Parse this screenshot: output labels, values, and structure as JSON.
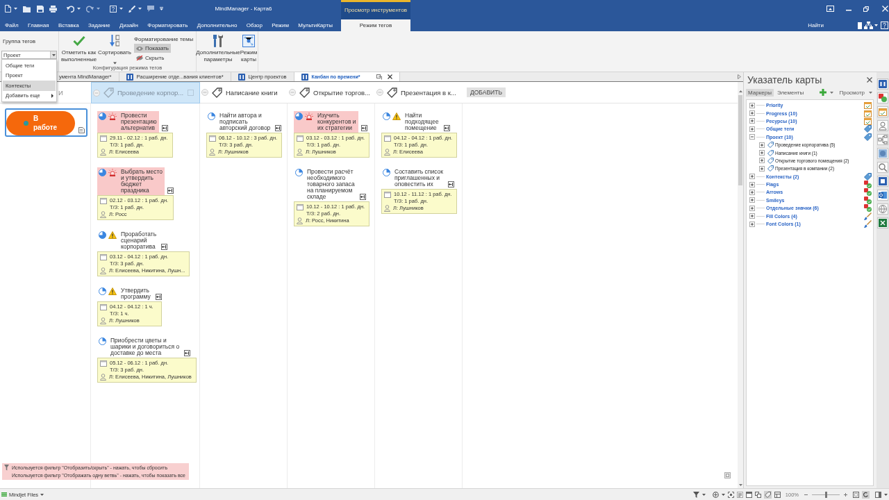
{
  "window": {
    "title": "MindManager - Карта6",
    "contextual_group": "Просмотр инструментов"
  },
  "ribbon": {
    "tabs": [
      {
        "label": "Файл",
        "kind": "standard",
        "selected": false
      },
      {
        "label": "Главная",
        "kind": "standard",
        "selected": false
      },
      {
        "label": "Вставка",
        "kind": "standard",
        "selected": false
      },
      {
        "label": "Задание",
        "kind": "standard",
        "selected": false
      },
      {
        "label": "Дизайн",
        "kind": "standard",
        "selected": false
      },
      {
        "label": "Форматировать",
        "kind": "standard",
        "selected": false
      },
      {
        "label": "Дополнительно",
        "kind": "standard",
        "selected": false
      },
      {
        "label": "Обзор",
        "kind": "standard",
        "selected": false
      },
      {
        "label": "Режим",
        "kind": "standard",
        "selected": false
      },
      {
        "label": "МультиКарты",
        "kind": "standard",
        "selected": false
      },
      {
        "label": "Режим тегов",
        "kind": "contextual",
        "selected": true
      }
    ],
    "search_label": "Найти",
    "tag_group": {
      "label": "Группа тегов",
      "value": "Проект",
      "menu": [
        {
          "label": "Общие теги",
          "highlighted": false,
          "submenu": false
        },
        {
          "label": "Проект",
          "highlighted": false,
          "submenu": false
        },
        {
          "label": "Контексты",
          "highlighted": true,
          "submenu": false
        },
        {
          "label": "Добавить еще",
          "highlighted": false,
          "submenu": true
        }
      ]
    },
    "mark_done_button": {
      "label": "Отметить как\nвыполненные"
    },
    "sort_button": {
      "label": "Сортировать"
    },
    "theme_formatting": {
      "label": "Форматирование темы",
      "options": [
        {
          "label": "Показать",
          "selected": true
        },
        {
          "label": "Скрыть",
          "selected": false
        }
      ]
    },
    "group_label": "Конфигурация режима тегов",
    "more_options_button": {
      "label": "Дополнительные\nпараметры"
    },
    "map_mode_button": {
      "label": "Режим\nкарты"
    }
  },
  "document_tabs": [
    {
      "label": "умента MindManager*",
      "icon": false,
      "selected": false
    },
    {
      "label": "Расширение отде...вания клиентов*",
      "icon": true,
      "selected": false
    },
    {
      "label": "Центр проектов",
      "icon": true,
      "selected": false
    },
    {
      "label": "Канбан по времени*",
      "icon": true,
      "selected": true
    }
  ],
  "kanban": {
    "columns": [
      {
        "title": "И",
        "kind": "untagged",
        "selected": false,
        "topics": [
          {
            "kind": "status",
            "title": "В\nработе",
            "selected": true
          }
        ]
      },
      {
        "title": "Проведение корпор...",
        "kind": "tag",
        "selected": true,
        "topics": [
          {
            "kind": "task",
            "title": "Провести\nпрезентацию\nальтернатив",
            "highlighted": true,
            "alarm": true,
            "warning": false,
            "mostly_done": true,
            "dates": "29.11 - 02.12 : 1 раб. дн.",
            "effort": "Т/З: 1 раб. дн.",
            "resources": "Л: Елисеева"
          },
          {
            "kind": "task",
            "title": "Выбрать место\nи утвердить\nбюджет\nпраздника",
            "highlighted": true,
            "alarm": true,
            "warning": false,
            "mostly_done": true,
            "dates": "02.12 - 03.12 : 1 раб. дн.",
            "effort": "Т/З: 1 раб. дн.",
            "resources": "Л: Росс"
          },
          {
            "kind": "task",
            "title": "Проработать\nсценарий\nкорпоратива",
            "highlighted": false,
            "alarm": false,
            "warning": true,
            "mostly_done": true,
            "dates": "03.12 - 04.12 : 1 раб. дн.",
            "effort": "Т/З: 3 раб. дн.",
            "resources": "Л: Елисеева, Никитина, Лушн..."
          },
          {
            "kind": "task",
            "title": "Утвердить\nпрограмму",
            "highlighted": false,
            "alarm": false,
            "warning": true,
            "mostly_done": false,
            "dates": "04.12 - 04.12 : 1 ч.",
            "effort": "Т/З: 1 ч.",
            "resources": "Л: Лушников"
          },
          {
            "kind": "task",
            "title": "Приобрести цветы и\nшарики и договориться о\nдоставке до места",
            "highlighted": false,
            "alarm": false,
            "warning": false,
            "mostly_done": false,
            "dates": "05.12 - 06.12 : 1 раб. дн.",
            "effort": "Т/З: 3 раб. дн.",
            "resources": "Л: Елисеева, Никитина, Лушников"
          }
        ]
      },
      {
        "title": "Написание книги",
        "kind": "tag",
        "selected": false,
        "topics": [
          {
            "kind": "task",
            "title": "Найти автора и\nподписать\nавторский договор",
            "highlighted": false,
            "alarm": false,
            "warning": false,
            "mostly_done": false,
            "dates": "06.12 - 10.12 : 3 раб. дн.",
            "effort": "Т/З: 3 раб. дн.",
            "resources": "Л: Лушников"
          }
        ]
      },
      {
        "title": "Открытие торгов...",
        "kind": "tag",
        "selected": false,
        "topics": [
          {
            "kind": "task",
            "title": "Изучить\nконкурентов и\nих стратегии",
            "highlighted": true,
            "alarm": true,
            "warning": false,
            "mostly_done": true,
            "dates": "03.12 - 03.12 : 1 раб. дн.",
            "effort": "Т/З: 1 раб. дн.",
            "resources": "Л: Лушников"
          },
          {
            "kind": "task",
            "title": "Провести расчёт\nнеобходимого\nтоварного запаса\nна планируемом\nскладе",
            "highlighted": false,
            "alarm": false,
            "warning": false,
            "mostly_done": false,
            "dates": "10.12 - 10.12 : 1 раб. дн.",
            "effort": "Т/З: 2 раб. дн.",
            "resources": "Л: Росс, Никитина"
          }
        ]
      },
      {
        "title": "Презентация в к...",
        "kind": "tag",
        "selected": false,
        "topics": [
          {
            "kind": "task",
            "title": "Найти\nподходящее\nпомещение",
            "highlighted": false,
            "alarm": false,
            "warning": true,
            "mostly_done": false,
            "dates": "04.12 - 04.12 : 1 раб. дн.",
            "effort": "Т/З: 1 раб. дн.",
            "resources": "Л: Елисеева"
          },
          {
            "kind": "task",
            "title": "Составить список\nприглашенных и\nоповестить их",
            "highlighted": false,
            "alarm": false,
            "warning": false,
            "mostly_done": false,
            "dates": "10.12 - 11.12 : 1 раб. дн.",
            "effort": "Т/З: 1 раб. дн.",
            "resources": "Л: Лушников"
          }
        ]
      }
    ],
    "add_button": "ДОБАВИТЬ"
  },
  "filter_notices": [
    "Используется фильтр \"Отобразить/скрыть\" - нажать, чтобы сбросить",
    "Используется фильтр \"Отображать одну ветвь\" - нажать, чтобы показать все"
  ],
  "map_index": {
    "title": "Указатель карты",
    "tabs": [
      {
        "label": "Маркеры",
        "selected": true
      },
      {
        "label": "Элементы",
        "selected": false
      }
    ],
    "view_label": "Просмотр",
    "groups": [
      {
        "label": "Priority",
        "kind": "task",
        "expanded": false
      },
      {
        "label": "Progress (10)",
        "kind": "task",
        "expanded": false
      },
      {
        "label": "Ресурсы (10)",
        "kind": "task",
        "expanded": false
      },
      {
        "label": "Общие теги",
        "kind": "tag",
        "expanded": false
      },
      {
        "label": "Проект (10)",
        "kind": "tag",
        "expanded": true,
        "children": [
          {
            "label": "Проведение корпоратива (5)",
            "expanded": false
          },
          {
            "label": "Написание книги (1)",
            "expanded": false
          },
          {
            "label": "Открытие торгового помещения (2)",
            "expanded": false
          },
          {
            "label": "Презентация в компании (2)",
            "expanded": false
          }
        ]
      },
      {
        "label": "Контексты (2)",
        "kind": "tag",
        "expanded": false
      },
      {
        "label": "Flags",
        "kind": "icon_set",
        "expanded": false
      },
      {
        "label": "Arrows",
        "kind": "icon_set",
        "expanded": false
      },
      {
        "label": "Smileys",
        "kind": "icon_set",
        "expanded": false
      },
      {
        "label": "Отдельные значки (6)",
        "kind": "icon_set",
        "expanded": false
      },
      {
        "label": "Fill Colors (4)",
        "kind": "color",
        "expanded": false
      },
      {
        "label": "Font Colors (1)",
        "kind": "color",
        "expanded": false
      }
    ]
  },
  "status_bar": {
    "files_label": "Mindjet Files",
    "zoom": "100%",
    "zoom_slider": {
      "level": 0.5
    }
  }
}
